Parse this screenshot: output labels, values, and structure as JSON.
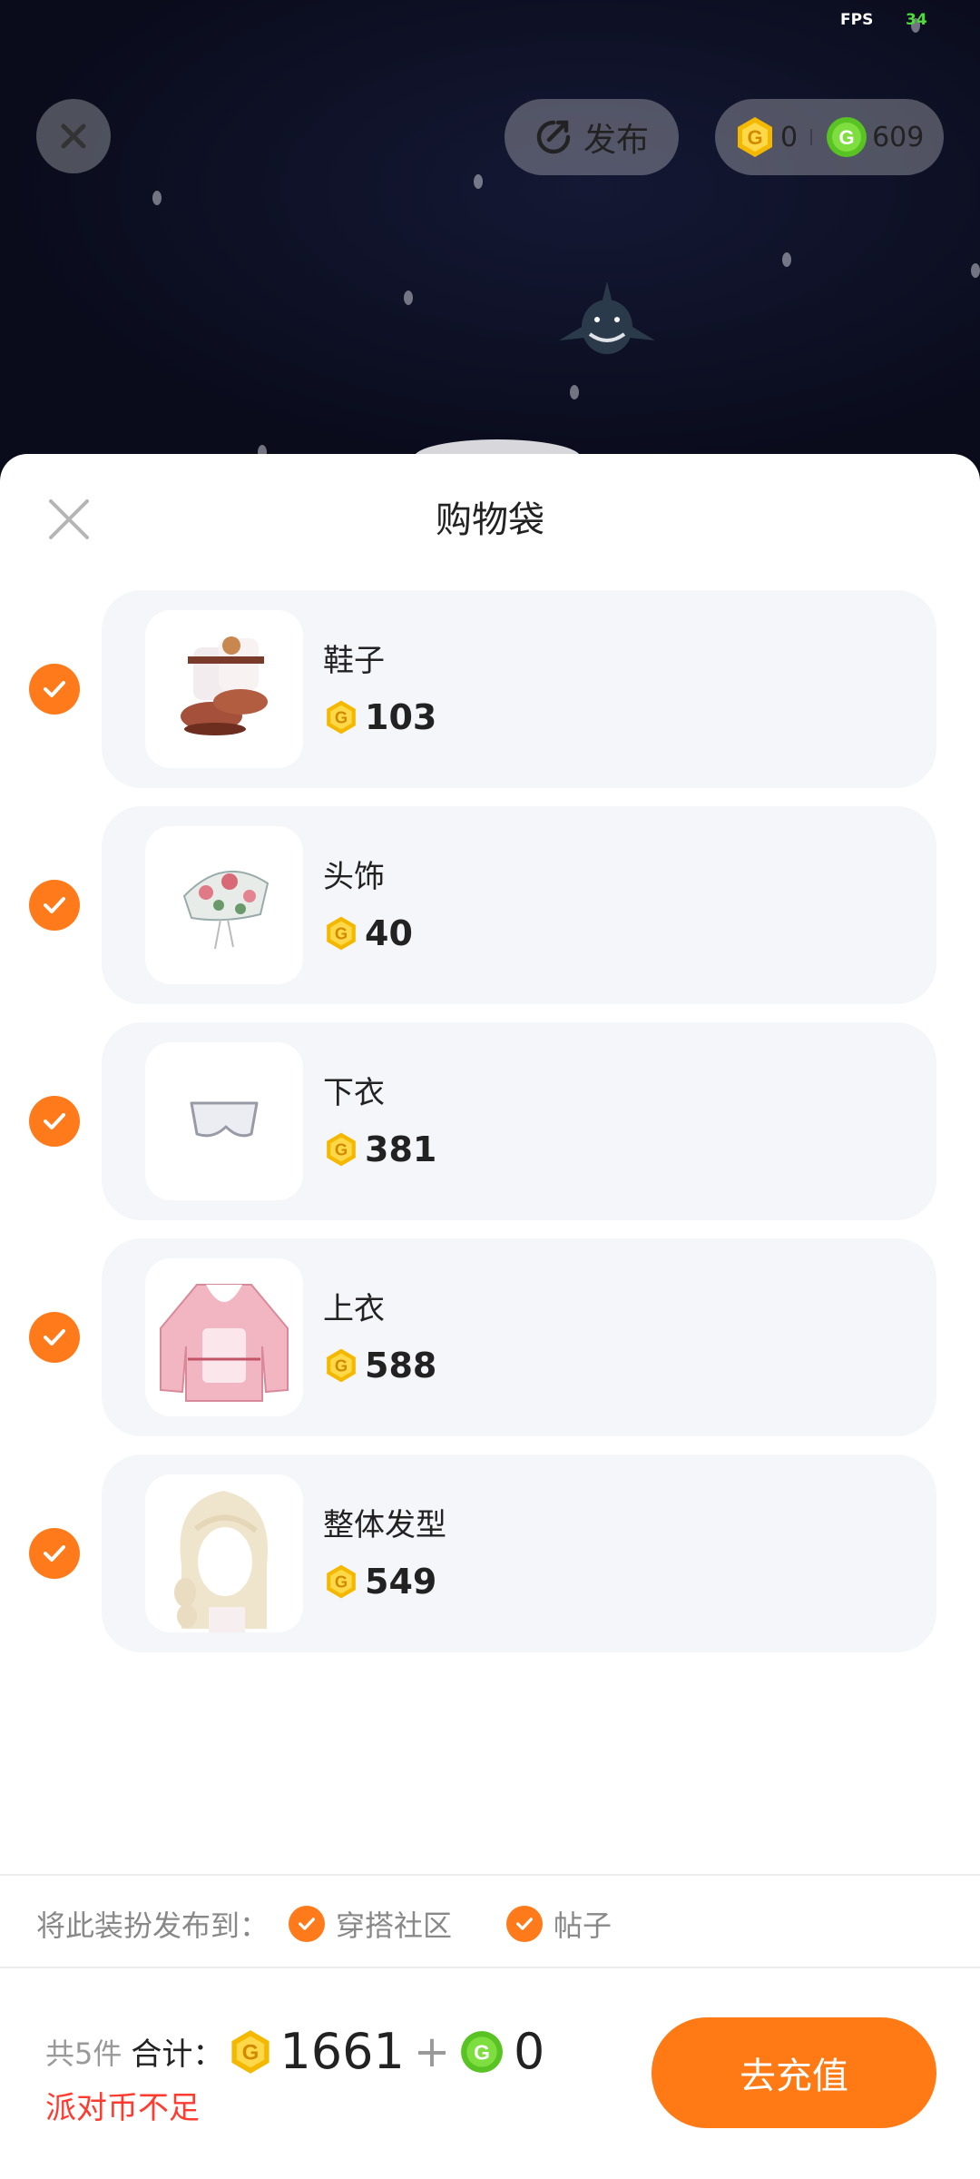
{
  "status": {
    "fps_label": "FPS",
    "fps_value": "34"
  },
  "top_bar": {
    "publish_label": "发布",
    "gold_balance": "0",
    "green_balance": "609"
  },
  "sheet": {
    "title": "购物袋",
    "items": [
      {
        "name": "鞋子",
        "price": "103",
        "selected": true,
        "icon": "boots-icon"
      },
      {
        "name": "头饰",
        "price": "40",
        "selected": true,
        "icon": "headwear-icon"
      },
      {
        "name": "下衣",
        "price": "381",
        "selected": true,
        "icon": "bottoms-icon"
      },
      {
        "name": "上衣",
        "price": "588",
        "selected": true,
        "icon": "sweater-icon"
      },
      {
        "name": "整体发型",
        "price": "549",
        "selected": true,
        "icon": "hairstyle-icon"
      }
    ]
  },
  "publish_to": {
    "label": "将此装扮发布到：",
    "options": [
      {
        "label": "穿搭社区",
        "checked": true
      },
      {
        "label": "帖子",
        "checked": true
      }
    ]
  },
  "footer": {
    "count_text": "共5件",
    "total_label": "合计：",
    "gold_total": "1661",
    "plus": "+",
    "green_total": "0",
    "warning": "派对币不足",
    "recharge_label": "去充值"
  },
  "colors": {
    "accent": "#ff7a1a",
    "gold_coin": "#f5b800",
    "green_coin": "#58c322",
    "warning": "#ff3b30"
  }
}
